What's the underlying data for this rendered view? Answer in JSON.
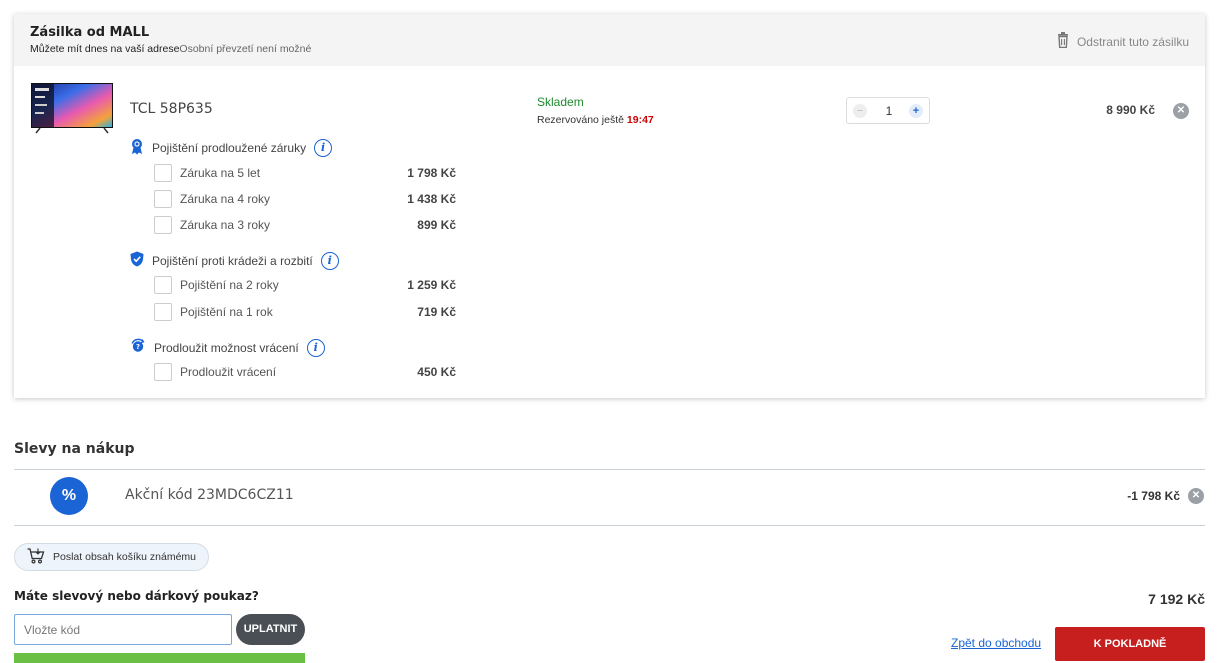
{
  "shipment": {
    "title": "Zásilka od MALL",
    "delivery_note": "Můžete mít dnes na vaší adrese",
    "pickup_note": "Osobní převzetí není možné",
    "remove_label": "Odstranit tuto zásilku"
  },
  "product": {
    "name": "TCL 58P635",
    "stock_status": "Skladem",
    "reserved_label": "Rezervováno ještě",
    "reserved_time": "19:47",
    "quantity": "1",
    "price": "8 990 Kč"
  },
  "insurance_groups": [
    {
      "title": "Pojištění prodloužené záruky",
      "icon": "medal-icon",
      "options": [
        {
          "label": "Záruka na 5 let",
          "price": "1 798 Kč"
        },
        {
          "label": "Záruka na 4 roky",
          "price": "1 438 Kč"
        },
        {
          "label": "Záruka na 3 roky",
          "price": "899 Kč"
        }
      ]
    },
    {
      "title": "Pojištění proti krádeži a rozbití",
      "icon": "shield-icon",
      "options": [
        {
          "label": "Pojištění na 2 roky",
          "price": "1 259 Kč"
        },
        {
          "label": "Pojištění na 1 rok",
          "price": "719 Kč"
        }
      ]
    },
    {
      "title": "Prodloužit možnost vrácení",
      "icon": "return-icon",
      "options": [
        {
          "label": "Prodloužit vrácení",
          "price": "450 Kč"
        }
      ]
    }
  ],
  "discounts": {
    "title": "Slevy na nákup",
    "icon_glyph": "%",
    "code_label": "Akční kód 23MDC6CZ11",
    "amount": "-1 798 Kč"
  },
  "share_button": "Poslat obsah košíku známému",
  "voucher": {
    "question": "Máte slevový nebo dárkový poukaz?",
    "placeholder": "Vložte kód",
    "apply_label": "UPLATNIT"
  },
  "total": "7 192 Kč",
  "back_link": "Zpět do obchodu",
  "checkout_label": "K POKLADNĚ",
  "colors": {
    "accent_blue": "#1a64d6",
    "stock_green": "#1e8a2e",
    "checkout_red": "#c71e1e",
    "progress_green": "#6cbf45"
  }
}
